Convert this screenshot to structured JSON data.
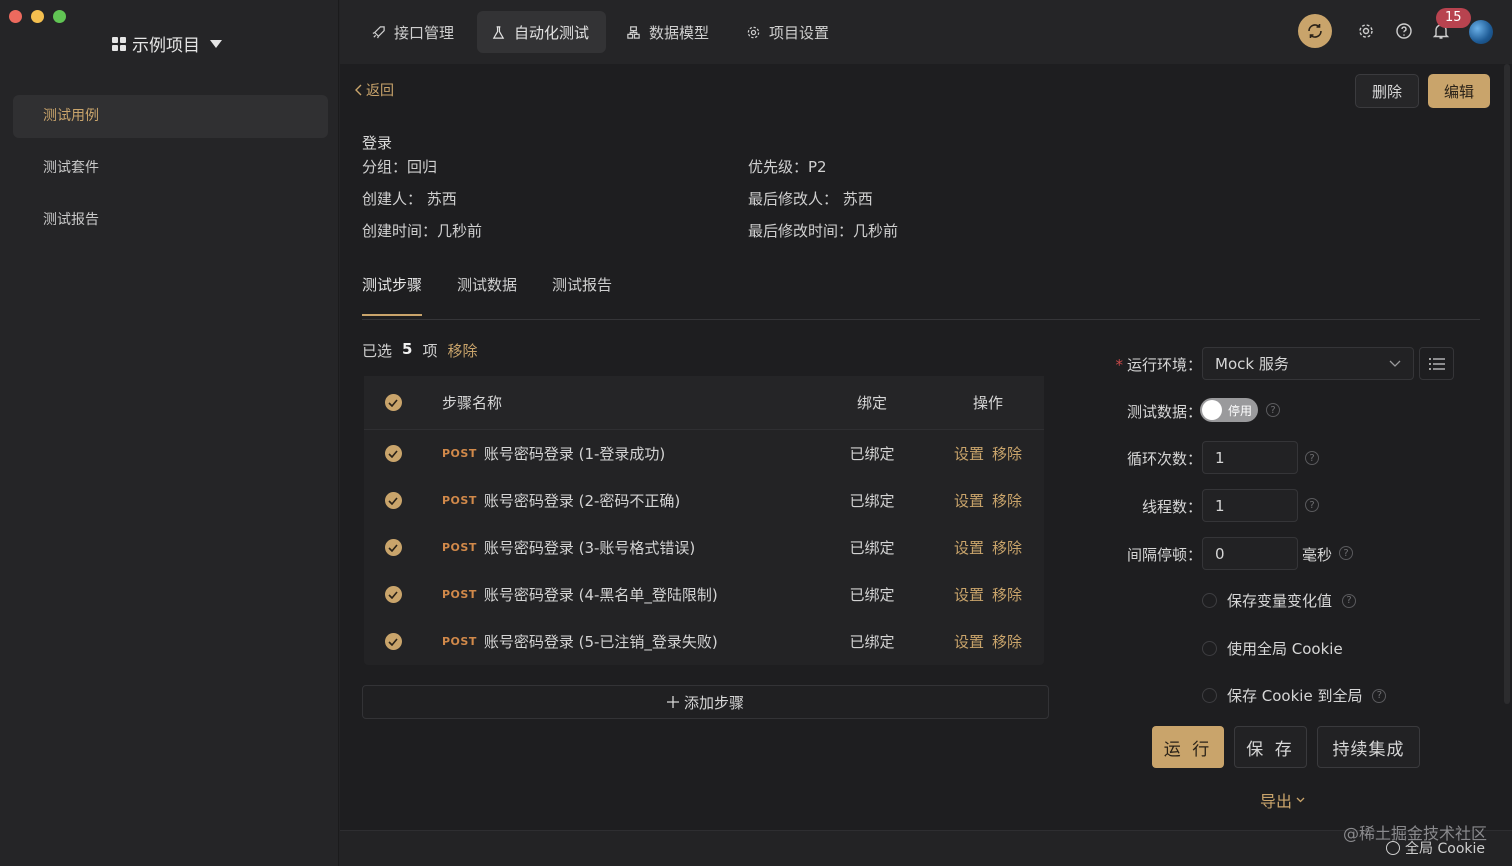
{
  "project": {
    "name": "示例项目"
  },
  "sidebar": {
    "items": [
      {
        "label": "测试用例"
      },
      {
        "label": "测试套件"
      },
      {
        "label": "测试报告"
      }
    ]
  },
  "nav": {
    "tabs": [
      {
        "label": "接口管理",
        "icon": "rocket-icon"
      },
      {
        "label": "自动化测试",
        "icon": "flask-icon"
      },
      {
        "label": "数据模型",
        "icon": "model-icon"
      },
      {
        "label": "项目设置",
        "icon": "gear-icon"
      }
    ]
  },
  "topbar": {
    "notification_count": "15"
  },
  "header": {
    "back_label": "返回",
    "delete_label": "删除",
    "edit_label": "编辑"
  },
  "case": {
    "name": "登录",
    "group": "分组：回归",
    "priority": "优先级：P2",
    "creator": "创建人：  苏西",
    "modifier": "最后修改人：  苏西",
    "created": "创建时间：几秒前",
    "modified": "最后修改时间：几秒前"
  },
  "tabs": [
    {
      "label": "测试步骤"
    },
    {
      "label": "测试数据"
    },
    {
      "label": "测试报告"
    }
  ],
  "selection": {
    "prefix": "已选",
    "count": "5",
    "suffix": "项",
    "remove": "移除"
  },
  "table": {
    "headers": {
      "name": "步骤名称",
      "bind": "绑定",
      "ops": "操作"
    },
    "rows": [
      {
        "method": "POST",
        "name": "账号密码登录 (1-登录成功)",
        "bind": "已绑定",
        "op1": "设置",
        "op2": "移除"
      },
      {
        "method": "POST",
        "name": "账号密码登录 (2-密码不正确)",
        "bind": "已绑定",
        "op1": "设置",
        "op2": "移除"
      },
      {
        "method": "POST",
        "name": "账号密码登录 (3-账号格式错误)",
        "bind": "已绑定",
        "op1": "设置",
        "op2": "移除"
      },
      {
        "method": "POST",
        "name": "账号密码登录 (4-黑名单_登陆限制)",
        "bind": "已绑定",
        "op1": "设置",
        "op2": "移除"
      },
      {
        "method": "POST",
        "name": "账号密码登录 (5-已注销_登录失败)",
        "bind": "已绑定",
        "op1": "设置",
        "op2": "移除"
      }
    ],
    "add_step": "添加步骤"
  },
  "form": {
    "env_label": "运行环境：",
    "env_value": "Mock 服务",
    "testdata_label": "测试数据：",
    "testdata_toggle": "停用",
    "loops_label": "循环次数：",
    "loops_value": "1",
    "threads_label": "线程数：",
    "threads_value": "1",
    "interval_label": "间隔停顿：",
    "interval_value": "0",
    "interval_unit": "毫秒",
    "opt_save_vars": "保存变量变化值",
    "opt_global_cookie": "使用全局 Cookie",
    "opt_save_cookie": "保存 Cookie 到全局",
    "run": "运 行",
    "save": "保 存",
    "ci": "持续集成",
    "export": "导出"
  },
  "footer": {
    "watermark": "@稀土掘金技术社区",
    "status": "全局 Cookie"
  },
  "colors": {
    "accent": "#c9a46b",
    "method": "#d1894a",
    "badge": "#b8434f"
  }
}
